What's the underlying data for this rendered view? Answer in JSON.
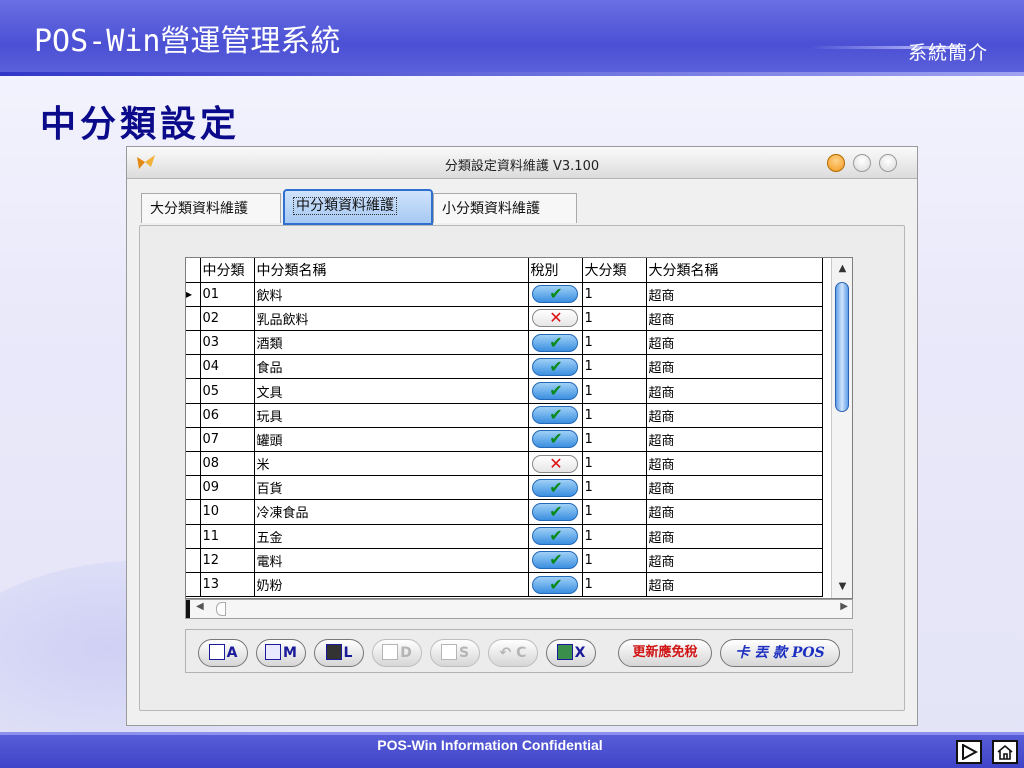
{
  "slide": {
    "brand": "POS-Win營運管理系統",
    "section_link": "系統簡介",
    "page_title": "中分類設定",
    "footer": "POS-Win Information Confidential"
  },
  "window": {
    "title": "分類設定資料維護 V3.100",
    "tabs": [
      {
        "label": "大分類資料維護"
      },
      {
        "label": "中分類資料維護"
      },
      {
        "label": "小分類資料維護"
      }
    ]
  },
  "grid": {
    "headers": [
      "中分類",
      "中分類名稱",
      "稅別",
      "大分類",
      "大分類名稱"
    ],
    "rows": [
      {
        "code": "01",
        "name": "飲料",
        "taxed": true,
        "major": "1",
        "major_name": "超商",
        "selected": true
      },
      {
        "code": "02",
        "name": "乳品飲料",
        "taxed": false,
        "major": "1",
        "major_name": "超商"
      },
      {
        "code": "03",
        "name": "酒類",
        "taxed": true,
        "major": "1",
        "major_name": "超商"
      },
      {
        "code": "04",
        "name": "食品",
        "taxed": true,
        "major": "1",
        "major_name": "超商"
      },
      {
        "code": "05",
        "name": "文具",
        "taxed": true,
        "major": "1",
        "major_name": "超商"
      },
      {
        "code": "06",
        "name": "玩具",
        "taxed": true,
        "major": "1",
        "major_name": "超商"
      },
      {
        "code": "07",
        "name": "罐頭",
        "taxed": true,
        "major": "1",
        "major_name": "超商"
      },
      {
        "code": "08",
        "name": "米",
        "taxed": false,
        "major": "1",
        "major_name": "超商"
      },
      {
        "code": "09",
        "name": "百貨",
        "taxed": true,
        "major": "1",
        "major_name": "超商"
      },
      {
        "code": "10",
        "name": "冷凍食品",
        "taxed": true,
        "major": "1",
        "major_name": "超商"
      },
      {
        "code": "11",
        "name": "五金",
        "taxed": true,
        "major": "1",
        "major_name": "超商"
      },
      {
        "code": "12",
        "name": "電料",
        "taxed": true,
        "major": "1",
        "major_name": "超商"
      },
      {
        "code": "13",
        "name": "奶粉",
        "taxed": true,
        "major": "1",
        "major_name": "超商"
      }
    ],
    "yes_mark": "✔",
    "no_mark": "✕"
  },
  "toolbar": {
    "add": "A",
    "modify": "M",
    "list": "L",
    "delete": "D",
    "save": "S",
    "undo": "C",
    "exit": "X",
    "update_tax": "更新應免稅",
    "pos_card": "卡 丟 款 POS"
  },
  "colors": {
    "accent": "#4b50d4",
    "title": "#0a0a8a"
  }
}
